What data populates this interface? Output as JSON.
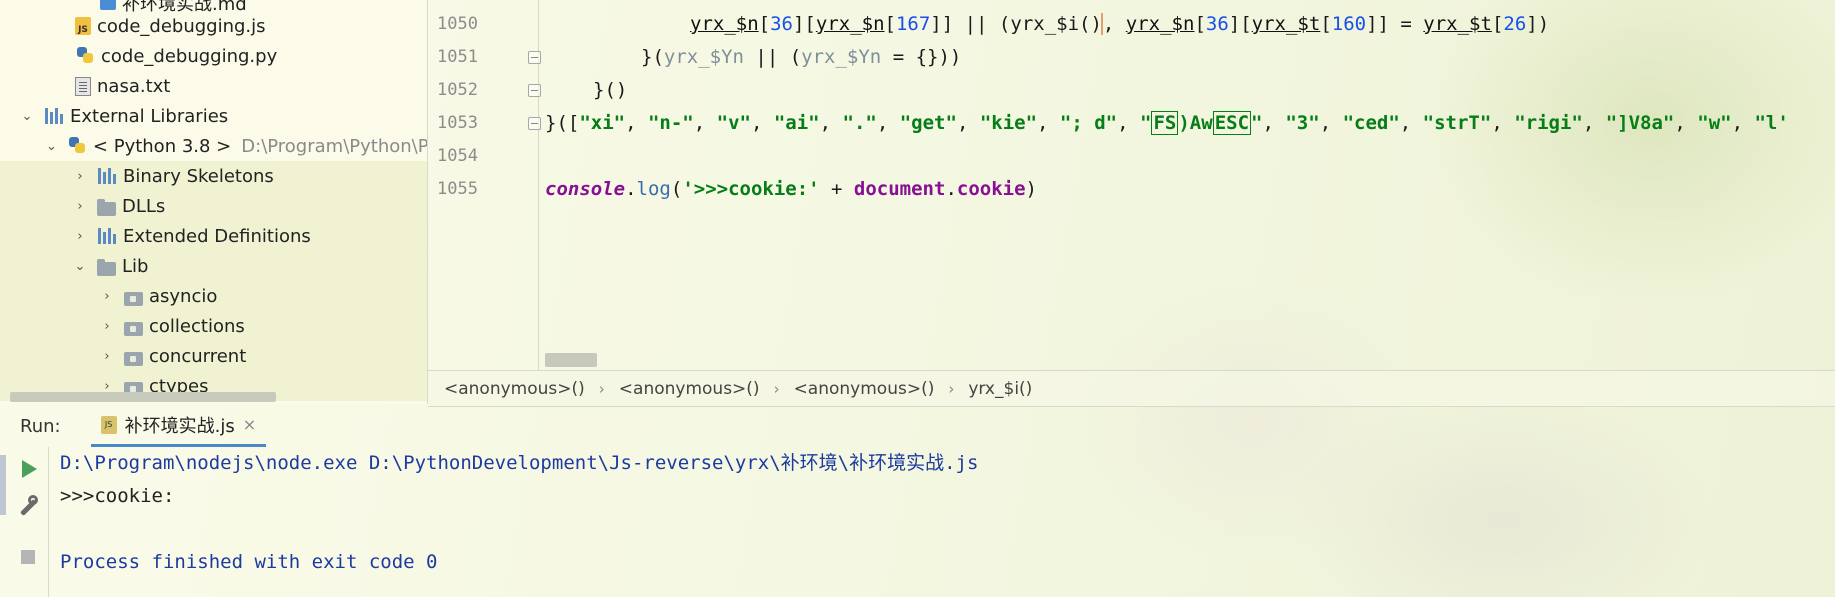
{
  "project_tree": {
    "items": [
      {
        "label": "补环境实战.md",
        "icon": "markdown-icon",
        "depth": 2,
        "arrow": ""
      },
      {
        "label": "code_debugging.js",
        "icon": "js-file-icon",
        "depth": 2,
        "arrow": ""
      },
      {
        "label": "code_debugging.py",
        "icon": "python-file-icon",
        "depth": 2,
        "arrow": ""
      },
      {
        "label": "nasa.txt",
        "icon": "text-file-icon",
        "depth": 2,
        "arrow": ""
      },
      {
        "label": "External Libraries",
        "icon": "library-icon",
        "depth": 0,
        "arrow": "⌄"
      },
      {
        "label": "< Python 3.8 >",
        "detail": "D:\\Program\\Python\\P",
        "icon": "python-sdk-icon",
        "depth": 1,
        "arrow": "⌄"
      },
      {
        "label": "Binary Skeletons",
        "icon": "library-icon",
        "depth": 2,
        "arrow": "›"
      },
      {
        "label": "DLLs",
        "icon": "folder-icon",
        "depth": 2,
        "arrow": "›"
      },
      {
        "label": "Extended Definitions",
        "icon": "library-icon",
        "depth": 2,
        "arrow": "›"
      },
      {
        "label": "Lib",
        "icon": "folder-icon",
        "depth": 2,
        "arrow": "⌄"
      },
      {
        "label": "asyncio",
        "icon": "package-icon",
        "depth": 3,
        "arrow": "›"
      },
      {
        "label": "collections",
        "icon": "package-icon",
        "depth": 3,
        "arrow": "›"
      },
      {
        "label": "concurrent",
        "icon": "package-icon",
        "depth": 3,
        "arrow": "›"
      },
      {
        "label": "ctypes",
        "icon": "package-icon",
        "depth": 3,
        "arrow": "›"
      }
    ]
  },
  "editor": {
    "line_numbers": [
      "1050",
      "1051",
      "1052",
      "1053",
      "1054",
      "1055"
    ],
    "line_1050": {
      "a": "yrx_$n",
      "b": "[",
      "c": "36",
      "d": "][",
      "e": "yrx_$n",
      "f": "[",
      "g": "167",
      "h": "]] || (",
      "i": "yrx_$i",
      "j": "()",
      "k": ", ",
      "l": "yrx_$n",
      "m": "[",
      "n": "36",
      "o": "][",
      "p": "yrx_$t",
      "q": "[",
      "r": "160",
      "s": "]] = ",
      "t": "yrx_$t",
      "u": "[",
      "v": "26",
      "w": "])"
    },
    "line_1051": {
      "a": "}(",
      "b": "yrx_$Yn",
      "c": " || (",
      "d": "yrx_$Yn",
      "e": " = {}))"
    },
    "line_1052": "}()",
    "line_1053": {
      "open": "}([",
      "s1": "\"xi\"",
      "s2": "\"n-\"",
      "s3": "\"v\"",
      "s4": "\"ai\"",
      "s5": "\".\"",
      "s6": "\"get\"",
      "s7": "\"kie\"",
      "s8": "\"; d\"",
      "s9a": "\"",
      "s9b": "FS",
      "s9c": ")Aw",
      "s9d": "ESC",
      "s9e": "\"",
      "s10": "\"3\"",
      "s11": "\"ced\"",
      "s12": "\"strT\"",
      "s13": "\"rigi\"",
      "s14": "\"]V8a\"",
      "s15": "\"w\"",
      "s16": "\"l'",
      "sep": ", "
    },
    "line_1055": {
      "obj": "console",
      "dot": ".",
      "fn": "log",
      "lp": "(",
      "str": "'>>>cookie:'",
      "plus": " + ",
      "doc": "document",
      "dot2": ".",
      "prop": "cookie",
      "rp": ")"
    }
  },
  "breadcrumb": {
    "items": [
      "<anonymous>()",
      "<anonymous>()",
      "<anonymous>()",
      "yrx_$i()"
    ],
    "separator": "›"
  },
  "run_panel": {
    "title": "Run:",
    "tab_label": "补环境实战.js",
    "tab_icon_text": "JS",
    "close_glyph": "×",
    "console_lines": {
      "command": "D:\\Program\\nodejs\\node.exe D:\\PythonDevelopment\\Js-reverse\\yrx\\补环境\\补环境实战.js",
      "output": ">>>cookie:",
      "exit": "Process finished with exit code 0"
    }
  },
  "colors": {
    "keyword": "#871094",
    "string": "#067d17",
    "number": "#1750eb",
    "console_command": "#1c3aa0",
    "run_tab_underline": "#4a88c7"
  }
}
